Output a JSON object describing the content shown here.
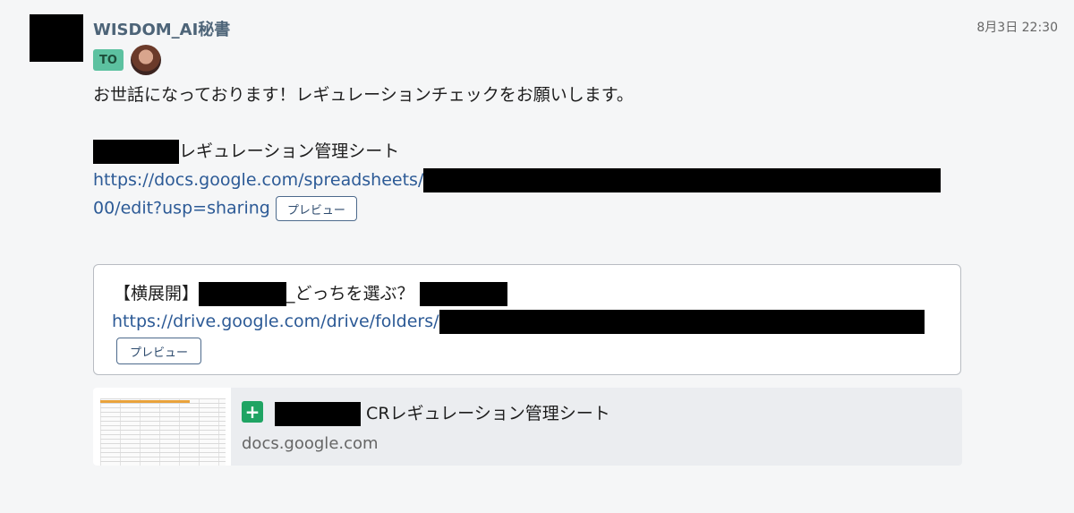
{
  "message": {
    "sender": "WISDOM_AI秘書",
    "timestamp": "8月3日 22:30",
    "to_label": "TO",
    "greeting": "お世話になっております！レギュレーションチェックをお願いします。",
    "sheet_title_suffix": "レギュレーション管理シート",
    "sheet_url_prefix": "https://docs.google.com/spreadsheets/",
    "sheet_url_suffix": "00/edit?usp=sharing",
    "preview_label": "プレビュー"
  },
  "quote": {
    "title_prefix": "【横展開】",
    "title_middle": "_どっちを選ぶ？",
    "url_prefix": "https://drive.google.com/drive/folders/",
    "preview_label": "プレビュー"
  },
  "link_card": {
    "icon": "google-sheets-icon",
    "title_suffix": "CRレギュレーション管理シート",
    "domain": "docs.google.com"
  }
}
